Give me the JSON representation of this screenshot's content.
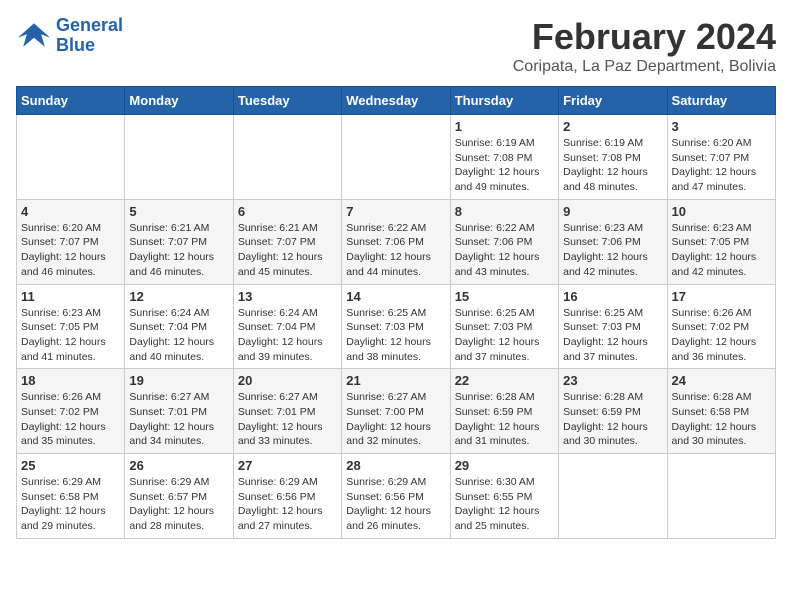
{
  "logo": {
    "line1": "General",
    "line2": "Blue"
  },
  "title": "February 2024",
  "location": "Coripata, La Paz Department, Bolivia",
  "days_of_week": [
    "Sunday",
    "Monday",
    "Tuesday",
    "Wednesday",
    "Thursday",
    "Friday",
    "Saturday"
  ],
  "weeks": [
    [
      {
        "day": "",
        "info": ""
      },
      {
        "day": "",
        "info": ""
      },
      {
        "day": "",
        "info": ""
      },
      {
        "day": "",
        "info": ""
      },
      {
        "day": "1",
        "info": "Sunrise: 6:19 AM\nSunset: 7:08 PM\nDaylight: 12 hours and 49 minutes."
      },
      {
        "day": "2",
        "info": "Sunrise: 6:19 AM\nSunset: 7:08 PM\nDaylight: 12 hours and 48 minutes."
      },
      {
        "day": "3",
        "info": "Sunrise: 6:20 AM\nSunset: 7:07 PM\nDaylight: 12 hours and 47 minutes."
      }
    ],
    [
      {
        "day": "4",
        "info": "Sunrise: 6:20 AM\nSunset: 7:07 PM\nDaylight: 12 hours and 46 minutes."
      },
      {
        "day": "5",
        "info": "Sunrise: 6:21 AM\nSunset: 7:07 PM\nDaylight: 12 hours and 46 minutes."
      },
      {
        "day": "6",
        "info": "Sunrise: 6:21 AM\nSunset: 7:07 PM\nDaylight: 12 hours and 45 minutes."
      },
      {
        "day": "7",
        "info": "Sunrise: 6:22 AM\nSunset: 7:06 PM\nDaylight: 12 hours and 44 minutes."
      },
      {
        "day": "8",
        "info": "Sunrise: 6:22 AM\nSunset: 7:06 PM\nDaylight: 12 hours and 43 minutes."
      },
      {
        "day": "9",
        "info": "Sunrise: 6:23 AM\nSunset: 7:06 PM\nDaylight: 12 hours and 42 minutes."
      },
      {
        "day": "10",
        "info": "Sunrise: 6:23 AM\nSunset: 7:05 PM\nDaylight: 12 hours and 42 minutes."
      }
    ],
    [
      {
        "day": "11",
        "info": "Sunrise: 6:23 AM\nSunset: 7:05 PM\nDaylight: 12 hours and 41 minutes."
      },
      {
        "day": "12",
        "info": "Sunrise: 6:24 AM\nSunset: 7:04 PM\nDaylight: 12 hours and 40 minutes."
      },
      {
        "day": "13",
        "info": "Sunrise: 6:24 AM\nSunset: 7:04 PM\nDaylight: 12 hours and 39 minutes."
      },
      {
        "day": "14",
        "info": "Sunrise: 6:25 AM\nSunset: 7:03 PM\nDaylight: 12 hours and 38 minutes."
      },
      {
        "day": "15",
        "info": "Sunrise: 6:25 AM\nSunset: 7:03 PM\nDaylight: 12 hours and 37 minutes."
      },
      {
        "day": "16",
        "info": "Sunrise: 6:25 AM\nSunset: 7:03 PM\nDaylight: 12 hours and 37 minutes."
      },
      {
        "day": "17",
        "info": "Sunrise: 6:26 AM\nSunset: 7:02 PM\nDaylight: 12 hours and 36 minutes."
      }
    ],
    [
      {
        "day": "18",
        "info": "Sunrise: 6:26 AM\nSunset: 7:02 PM\nDaylight: 12 hours and 35 minutes."
      },
      {
        "day": "19",
        "info": "Sunrise: 6:27 AM\nSunset: 7:01 PM\nDaylight: 12 hours and 34 minutes."
      },
      {
        "day": "20",
        "info": "Sunrise: 6:27 AM\nSunset: 7:01 PM\nDaylight: 12 hours and 33 minutes."
      },
      {
        "day": "21",
        "info": "Sunrise: 6:27 AM\nSunset: 7:00 PM\nDaylight: 12 hours and 32 minutes."
      },
      {
        "day": "22",
        "info": "Sunrise: 6:28 AM\nSunset: 6:59 PM\nDaylight: 12 hours and 31 minutes."
      },
      {
        "day": "23",
        "info": "Sunrise: 6:28 AM\nSunset: 6:59 PM\nDaylight: 12 hours and 30 minutes."
      },
      {
        "day": "24",
        "info": "Sunrise: 6:28 AM\nSunset: 6:58 PM\nDaylight: 12 hours and 30 minutes."
      }
    ],
    [
      {
        "day": "25",
        "info": "Sunrise: 6:29 AM\nSunset: 6:58 PM\nDaylight: 12 hours and 29 minutes."
      },
      {
        "day": "26",
        "info": "Sunrise: 6:29 AM\nSunset: 6:57 PM\nDaylight: 12 hours and 28 minutes."
      },
      {
        "day": "27",
        "info": "Sunrise: 6:29 AM\nSunset: 6:56 PM\nDaylight: 12 hours and 27 minutes."
      },
      {
        "day": "28",
        "info": "Sunrise: 6:29 AM\nSunset: 6:56 PM\nDaylight: 12 hours and 26 minutes."
      },
      {
        "day": "29",
        "info": "Sunrise: 6:30 AM\nSunset: 6:55 PM\nDaylight: 12 hours and 25 minutes."
      },
      {
        "day": "",
        "info": ""
      },
      {
        "day": "",
        "info": ""
      }
    ]
  ]
}
